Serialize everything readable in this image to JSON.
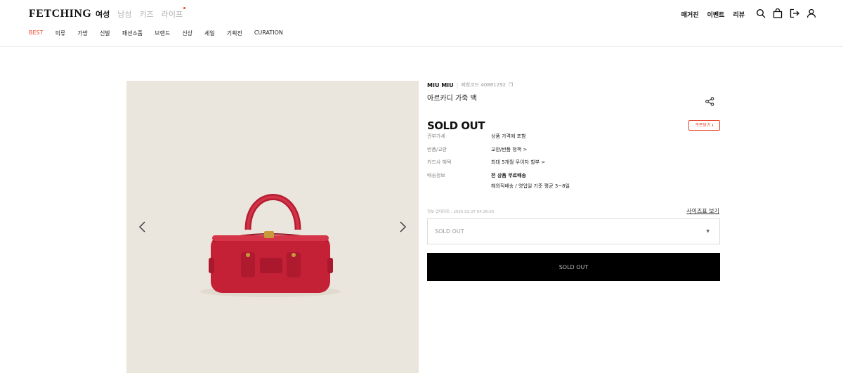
{
  "header": {
    "logo": "FETCHING",
    "gender_tabs": [
      {
        "label": "여성"
      },
      {
        "label": "남성"
      },
      {
        "label": "키즈"
      },
      {
        "label": "라이프"
      }
    ],
    "categories": [
      "BEST",
      "의류",
      "가방",
      "신발",
      "패션소품",
      "브랜드",
      "신상",
      "세일",
      "기획전",
      "CURATION"
    ],
    "right_links": [
      "매거진",
      "이벤트",
      "리뷰"
    ],
    "icons": [
      "search-icon",
      "bag-icon",
      "logout-icon",
      "user-icon"
    ],
    "accent_color": "#e8442b"
  },
  "product": {
    "brand": "MIU MIU",
    "code": "페칭코드 40881292",
    "name": "아르카디 가죽 백",
    "status": "SOLD OUT",
    "coupon": "쿠폰받기 ⭳",
    "info": [
      {
        "key": "관부가세",
        "value": "상품 가격에 포함"
      },
      {
        "key": "반품/교환",
        "value": "교환/반품 정책 >"
      },
      {
        "key": "카드사 혜택",
        "value": "최대 5개월 무이자 할부 >"
      },
      {
        "key": "배송정보",
        "value": "전 상품 무료배송",
        "value2": "해외직배송 / 영업일 기준 평균 3~8일"
      }
    ],
    "updated": "정보 업데이트 : 2025.02.07 04:36:55",
    "size_chart": "사이즈표 보기",
    "select_value": "SOLD OUT",
    "buy_button": "SOLD OUT"
  }
}
